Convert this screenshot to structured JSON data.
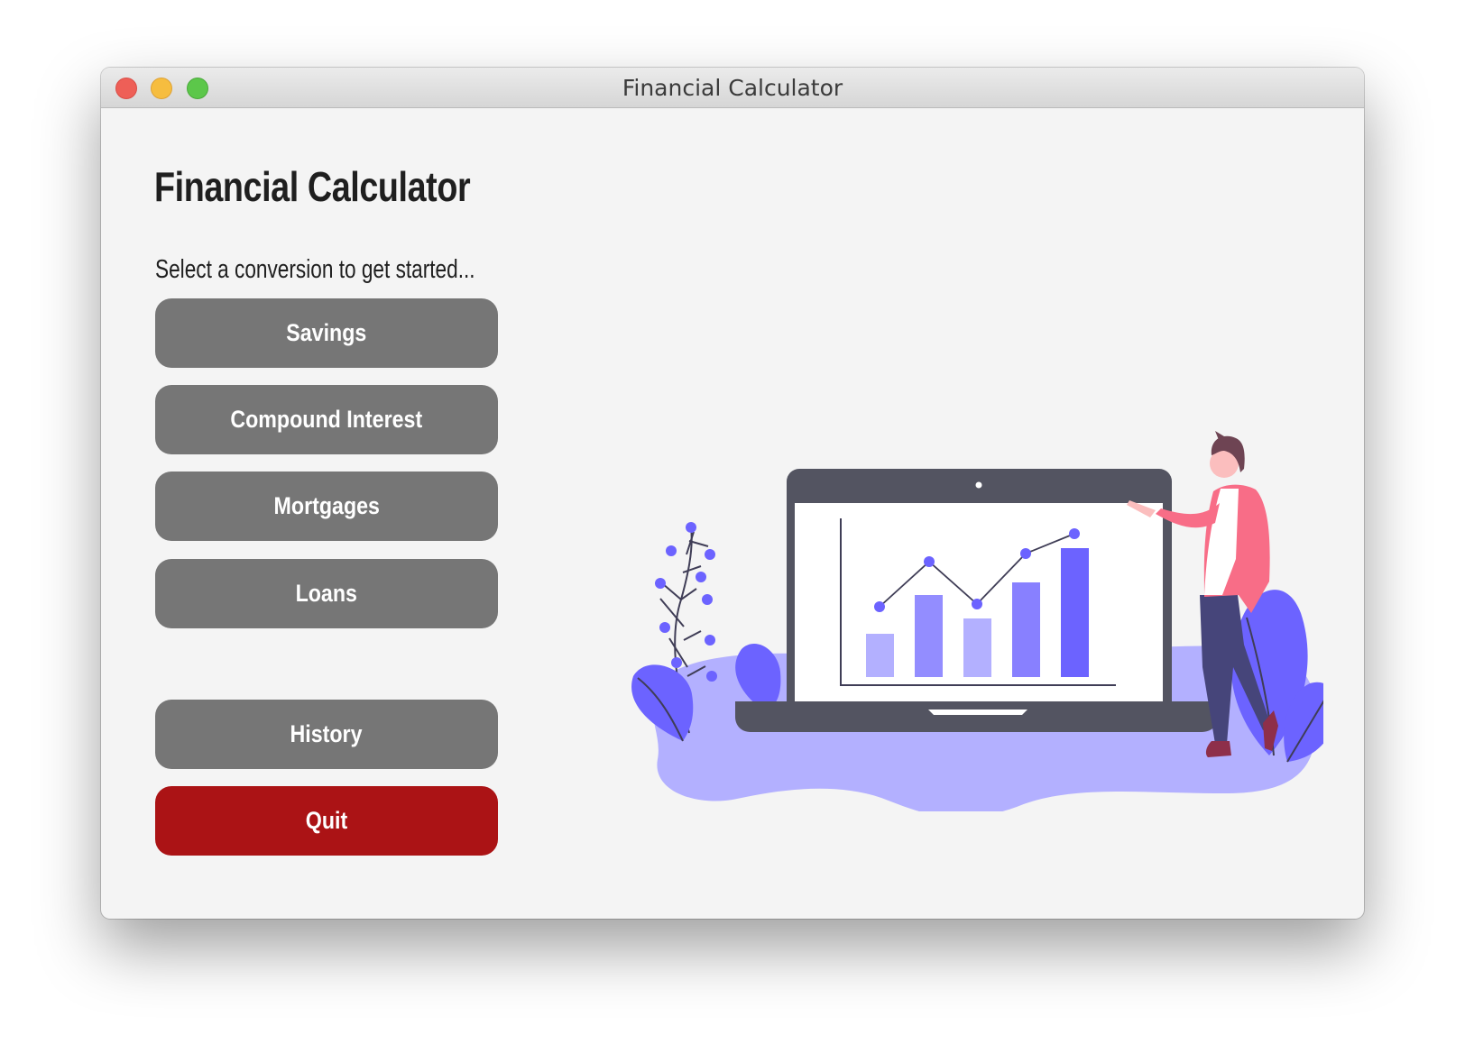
{
  "window": {
    "title": "Financial Calculator"
  },
  "header": {
    "title": "Financial Calculator",
    "subtitle": "Select a conversion to get started..."
  },
  "menu": {
    "buttons": [
      {
        "label": "Savings"
      },
      {
        "label": "Compound Interest"
      },
      {
        "label": "Mortgages"
      },
      {
        "label": "Loans"
      }
    ],
    "history_label": "History",
    "quit_label": "Quit"
  },
  "colors": {
    "button_gray": "#767676",
    "quit_red": "#ab1315",
    "accent_purple": "#6c63ff",
    "background": "#f4f4f4"
  },
  "illustration": {
    "icon": "person-presenting-chart-on-laptop"
  }
}
